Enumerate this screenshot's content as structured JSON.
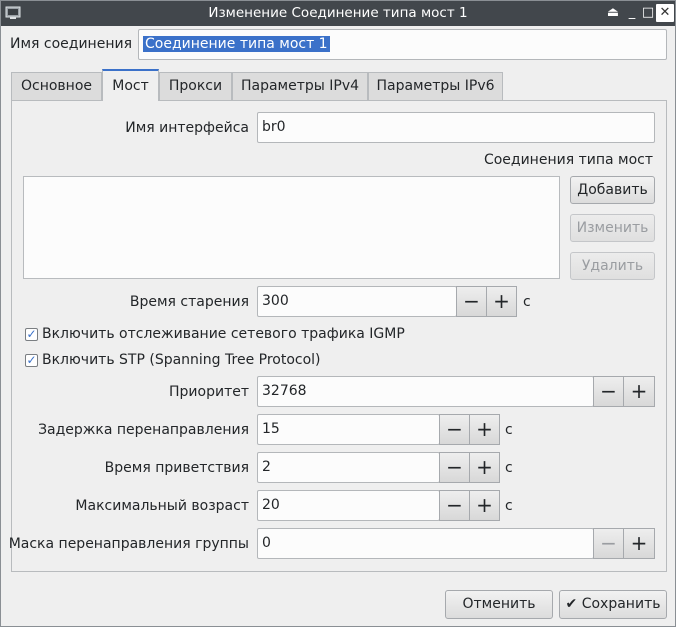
{
  "window": {
    "title": "Изменение Соединение типа мост 1",
    "shade_glyph": "⏏",
    "min_glyph": "_",
    "max_glyph": "□",
    "close_glyph": "✕"
  },
  "connection": {
    "name_label": "Имя соединения",
    "name_value": "Соединение типа мост 1"
  },
  "tabs": [
    {
      "label": "Основное"
    },
    {
      "label": "Мост"
    },
    {
      "label": "Прокси"
    },
    {
      "label": "Параметры IPv4"
    },
    {
      "label": "Параметры IPv6"
    }
  ],
  "bridge": {
    "interface_label": "Имя интерфейса",
    "interface_value": "br0",
    "connections_label": "Соединения типа мост",
    "add_label": "Добавить",
    "edit_label": "Изменить",
    "delete_label": "Удалить",
    "aging_label": "Время старения",
    "aging_value": "300",
    "igmp_label": "Включить отслеживание сетевого трафика IGMP",
    "stp_label": "Включить STP (Spanning Tree Protocol)",
    "priority_label": "Приоритет",
    "priority_value": "32768",
    "forward_delay_label": "Задержка перенаправления",
    "forward_delay_value": "15",
    "hello_label": "Время приветствия",
    "hello_value": "2",
    "max_age_label": "Максимальный возраст",
    "max_age_value": "20",
    "group_mask_label": "Маска перенаправления группы",
    "group_mask_value": "0",
    "unit_seconds": "с",
    "minus": "−",
    "plus": "+"
  },
  "footer": {
    "cancel_label": "Отменить",
    "save_label": "Сохранить",
    "save_icon": "✔"
  }
}
